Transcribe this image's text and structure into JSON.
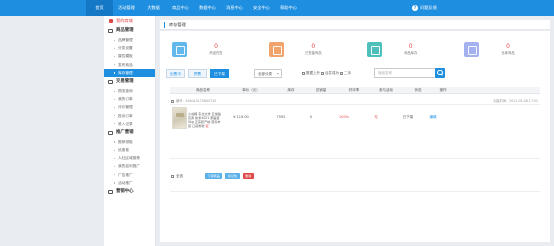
{
  "topnav": {
    "items": [
      "首页",
      "活动管理",
      "大数据",
      "商品中心",
      "数据中心",
      "消息中心",
      "安全中心",
      "帮助中心"
    ],
    "active_index": 0,
    "user_label": "问题反馈"
  },
  "sidebar": {
    "home_label": "我的商城",
    "groups": [
      {
        "title": "商品管理",
        "items": [
          "品牌管理",
          "分类设置",
          "属性模板",
          "发布商品",
          "库存管理"
        ]
      },
      {
        "title": "交易管理",
        "items": [
          "物流查询",
          "我的订单",
          "评价管理",
          "投诉订单",
          "收入记录"
        ]
      },
      {
        "title": "推广营销",
        "items": [
          "推荐领取",
          "优惠卷",
          "人社区域推荐",
          "我的返利推广",
          "广告推广",
          "活动推广"
        ]
      },
      {
        "title": "营销中心",
        "items": []
      }
    ],
    "active_item": "库存管理"
  },
  "breadcrumb": "库存管理",
  "stats": [
    {
      "value": "0",
      "label": "商品在售",
      "color": "#62b8ea"
    },
    {
      "value": "0",
      "label": "已售罄商品",
      "color": "#f0a46c"
    },
    {
      "value": "0",
      "label": "商品库存",
      "color": "#4fbfbb"
    },
    {
      "value": "0",
      "label": "仓库商品",
      "color": "#a3b1f0"
    }
  ],
  "filters": {
    "tabs": [
      "出售中",
      "预售",
      "已下架"
    ],
    "active_tab": 2,
    "select_value": "全部分类",
    "checkboxes": [
      "数据上升",
      "合并成为",
      "二手"
    ],
    "search_placeholder": "商品名称"
  },
  "table": {
    "headers": [
      "商品名称",
      "单价（元）",
      "库存",
      "总销量",
      "好评率",
      "参与活动",
      "状态",
      "操作"
    ]
  },
  "order": {
    "order_no": "编号：A9A4LSL7SNXXT4S",
    "time": "创建时间：2021-05-08 17:02",
    "product_name": "小谷粮 东北大米 五常稻花香 新米2021 家庭装 5kg 正宗原产地 营养丰富 口感香软",
    "product_tag": "促",
    "price": "¥ 119.00",
    "stock": "7592",
    "sales": "0",
    "rating": "100%",
    "activity": "无",
    "status": "已下架",
    "action": "编辑"
  },
  "bulk": {
    "all_label": "全选",
    "buttons": [
      "下架商品",
      "标记热",
      "删除"
    ]
  }
}
